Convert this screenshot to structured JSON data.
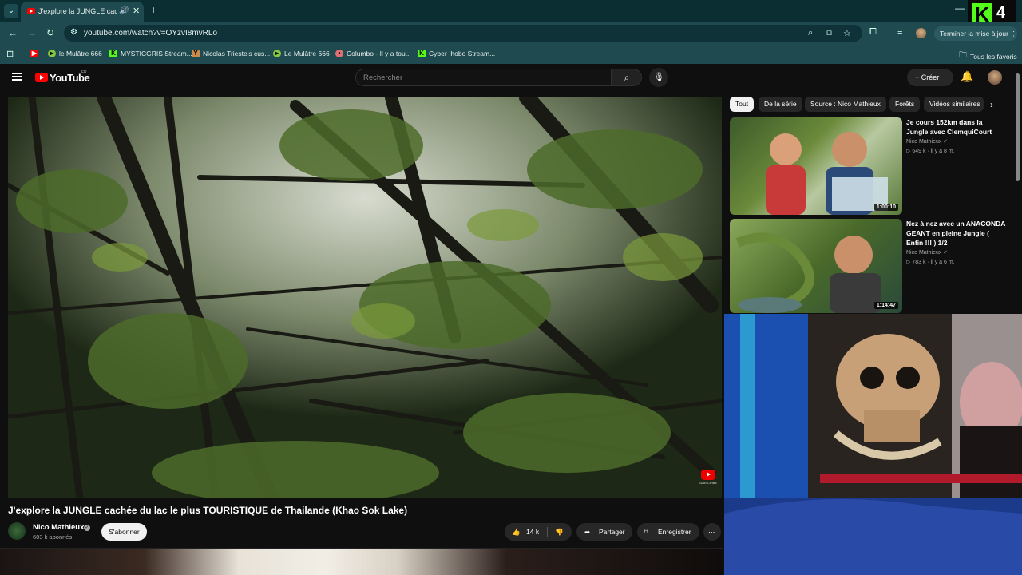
{
  "browser": {
    "tab_title": "J'explore la JUNGLE cachée",
    "url": "youtube.com/watch?v=OYzvI8mvRLo",
    "update_button": "Terminer la mise à jour",
    "bookmarks": [
      {
        "label": "",
        "icon": "youtube-icon",
        "color": "#ff0000"
      },
      {
        "label": "le Mulâtre 666",
        "icon": "rumble-icon",
        "color": "#85c742"
      },
      {
        "label": "MYSTICGRIS Stream...",
        "icon": "kick-icon",
        "color": "#53fc18"
      },
      {
        "label": "Nicolas Trieste's cus...",
        "icon": "deer-icon",
        "color": "#c98a4a"
      },
      {
        "label": "Le Mulâtre 666",
        "icon": "rumble-icon",
        "color": "#85c742"
      },
      {
        "label": "Columbo - Il y a tou...",
        "icon": "columbo-icon",
        "color": "#e07070"
      },
      {
        "label": "Cyber_hobo Stream...",
        "icon": "kick-icon",
        "color": "#53fc18"
      }
    ],
    "all_bookmarks": "Tous les favoris"
  },
  "overlay": {
    "kick_badge_number": "4"
  },
  "youtube": {
    "logo_text": "YouTube",
    "logo_region": "FR",
    "search_placeholder": "Rechercher",
    "create_label": "Créer",
    "video": {
      "title": "J'explore la JUNGLE cachée du lac le plus TOURISTIQUE de Thailande (Khao Sok Lake)",
      "channel": "Nico Mathieux",
      "subscribers": "603 k abonnés",
      "subscribe_label": "S'abonner",
      "likes": "14 k",
      "share_label": "Partager",
      "save_label": "Enregistrer",
      "watermark": "SUBSCRIBE"
    },
    "chips": [
      "Tout",
      "De la série",
      "Source : Nico Mathieux",
      "Forêts",
      "Vidéos similaires"
    ],
    "recommendations": [
      {
        "title": "Je cours 152km dans la Jungle avec ClemquiCourt",
        "channel": "Nico Mathieux",
        "meta": "649 k · il y a 8 m.",
        "duration": "1:00:10"
      },
      {
        "title": "Nez à nez avec un ANACONDA GEANT en pleine Jungle ( Enfin !!! ) 1/2",
        "channel": "Nico Mathieux",
        "meta": "783 k · il y a 6 m.",
        "duration": "1:14:47"
      }
    ]
  },
  "colors": {
    "youtube_red": "#ff0000",
    "kick_green": "#53fc18",
    "chrome_teal": "#1f4a4f",
    "yt_bg": "#0f0f0f"
  }
}
